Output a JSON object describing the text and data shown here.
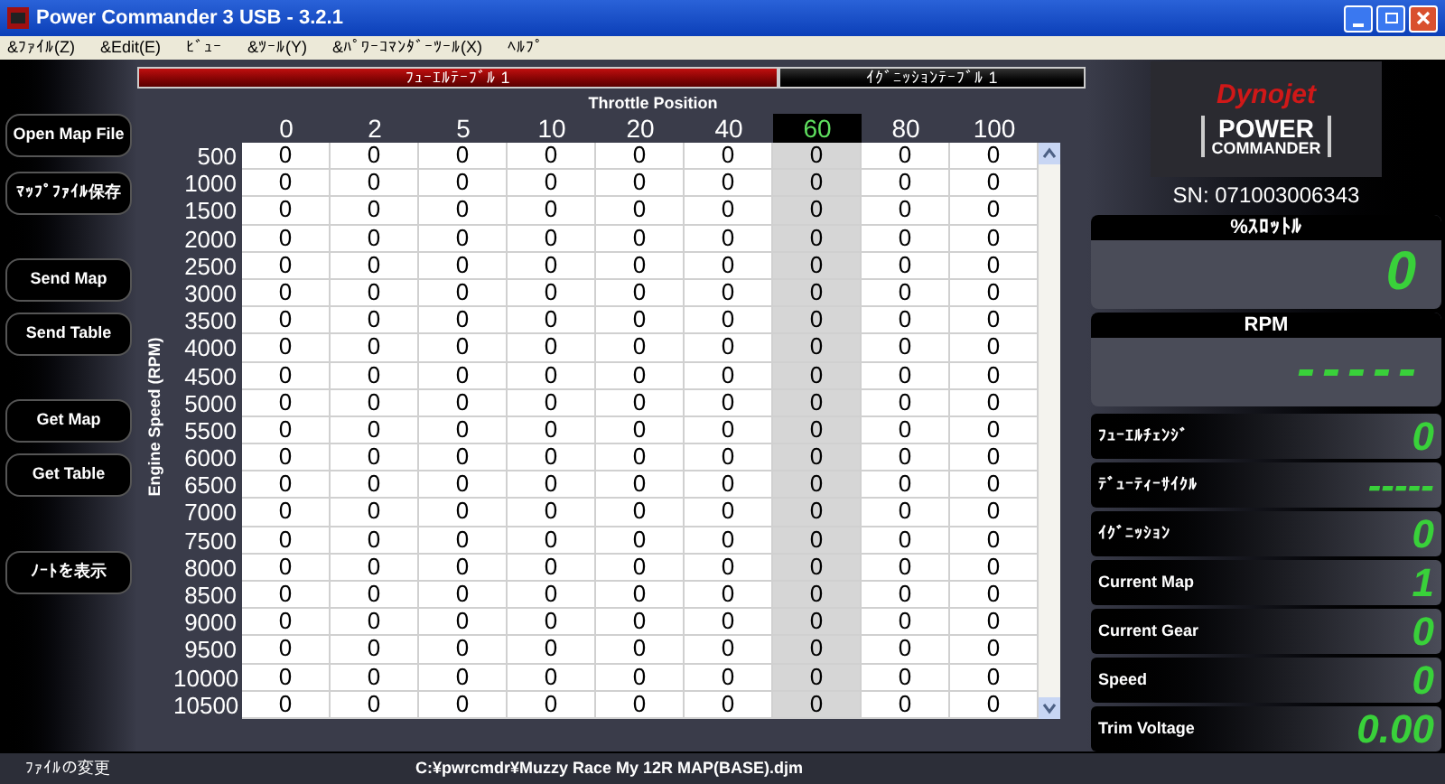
{
  "window": {
    "title": "Power Commander 3 USB - 3.2.1"
  },
  "menu": [
    "&ﾌｧｲﾙ(Z)",
    "&Edit(E)",
    "ﾋﾞｭｰ",
    "&ﾂｰﾙ(Y)",
    "&ﾊﾟﾜｰｺﾏﾝﾀﾞｰﾂｰﾙ(X)",
    "ﾍﾙﾌﾟ"
  ],
  "sidebar_buttons": [
    "Open Map File",
    "ﾏｯﾌﾟﾌｧｲﾙ保存",
    "Send Map",
    "Send Table",
    "Get Map",
    "Get Table",
    "ﾉｰﾄを表示"
  ],
  "tabs": [
    {
      "label": "ﾌｭｰｴﾙﾃｰﾌﾞﾙ 1",
      "selected": true
    },
    {
      "label": "ｲｸﾞﾆｯｼｮﾝﾃｰﾌﾞﾙ 1",
      "selected": false
    }
  ],
  "table": {
    "x_title": "Throttle Position",
    "y_title": "Engine Speed (RPM)",
    "columns": [
      {
        "label": "0",
        "selected": false
      },
      {
        "label": "2",
        "selected": false
      },
      {
        "label": "5",
        "selected": false
      },
      {
        "label": "10",
        "selected": false
      },
      {
        "label": "20",
        "selected": false
      },
      {
        "label": "40",
        "selected": false
      },
      {
        "label": "60",
        "selected": true
      },
      {
        "label": "80",
        "selected": false
      },
      {
        "label": "100",
        "selected": false
      }
    ],
    "rows": [
      {
        "rpm": "500",
        "cells": [
          "0",
          "0",
          "0",
          "0",
          "0",
          "0",
          "0",
          "0",
          "0"
        ]
      },
      {
        "rpm": "1000",
        "cells": [
          "0",
          "0",
          "0",
          "0",
          "0",
          "0",
          "0",
          "0",
          "0"
        ]
      },
      {
        "rpm": "1500",
        "cells": [
          "0",
          "0",
          "0",
          "0",
          "0",
          "0",
          "0",
          "0",
          "0"
        ]
      },
      {
        "rpm": "2000",
        "cells": [
          "0",
          "0",
          "0",
          "0",
          "0",
          "0",
          "0",
          "0",
          "0"
        ]
      },
      {
        "rpm": "2500",
        "cells": [
          "0",
          "0",
          "0",
          "0",
          "0",
          "0",
          "0",
          "0",
          "0"
        ]
      },
      {
        "rpm": "3000",
        "cells": [
          "0",
          "0",
          "0",
          "0",
          "0",
          "0",
          "0",
          "0",
          "0"
        ]
      },
      {
        "rpm": "3500",
        "cells": [
          "0",
          "0",
          "0",
          "0",
          "0",
          "0",
          "0",
          "0",
          "0"
        ]
      },
      {
        "rpm": "4000",
        "cells": [
          "0",
          "0",
          "0",
          "0",
          "0",
          "0",
          "0",
          "0",
          "0"
        ]
      },
      {
        "rpm": "4500",
        "cells": [
          "0",
          "0",
          "0",
          "0",
          "0",
          "0",
          "0",
          "0",
          "0"
        ]
      },
      {
        "rpm": "5000",
        "cells": [
          "0",
          "0",
          "0",
          "0",
          "0",
          "0",
          "0",
          "0",
          "0"
        ]
      },
      {
        "rpm": "5500",
        "cells": [
          "0",
          "0",
          "0",
          "0",
          "0",
          "0",
          "0",
          "0",
          "0"
        ]
      },
      {
        "rpm": "6000",
        "cells": [
          "0",
          "0",
          "0",
          "0",
          "0",
          "0",
          "0",
          "0",
          "0"
        ]
      },
      {
        "rpm": "6500",
        "cells": [
          "0",
          "0",
          "0",
          "0",
          "0",
          "0",
          "0",
          "0",
          "0"
        ]
      },
      {
        "rpm": "7000",
        "cells": [
          "0",
          "0",
          "0",
          "0",
          "0",
          "0",
          "0",
          "0",
          "0"
        ]
      },
      {
        "rpm": "7500",
        "cells": [
          "0",
          "0",
          "0",
          "0",
          "0",
          "0",
          "0",
          "0",
          "0"
        ]
      },
      {
        "rpm": "8000",
        "cells": [
          "0",
          "0",
          "0",
          "0",
          "0",
          "0",
          "0",
          "0",
          "0"
        ]
      },
      {
        "rpm": "8500",
        "cells": [
          "0",
          "0",
          "0",
          "0",
          "0",
          "0",
          "0",
          "0",
          "0"
        ]
      },
      {
        "rpm": "9000",
        "cells": [
          "0",
          "0",
          "0",
          "0",
          "0",
          "0",
          "0",
          "0",
          "0"
        ]
      },
      {
        "rpm": "9500",
        "cells": [
          "0",
          "0",
          "0",
          "0",
          "0",
          "0",
          "0",
          "0",
          "0"
        ]
      },
      {
        "rpm": "10000",
        "cells": [
          "0",
          "0",
          "0",
          "0",
          "0",
          "0",
          "0",
          "0",
          "0"
        ]
      },
      {
        "rpm": "10500",
        "cells": [
          "0",
          "0",
          "0",
          "0",
          "0",
          "0",
          "0",
          "0",
          "0"
        ]
      }
    ]
  },
  "logo": {
    "brand": "Dynojet",
    "product_line1": "POWER",
    "product_line2": "COMMANDER"
  },
  "serial": "SN: 071003006343",
  "big_gauges": [
    {
      "label": "%ｽﾛｯﾄﾙ",
      "value": "0"
    },
    {
      "label": "RPM",
      "value": "-----"
    }
  ],
  "small_gauges": [
    {
      "label": "ﾌｭｰｴﾙﾁｪﾝｼﾞ",
      "value": "0"
    },
    {
      "label": "ﾃﾞｭｰﾃｨｰｻｲｸﾙ",
      "value": "-----"
    },
    {
      "label": "ｲｸﾞﾆｯｼｮﾝ",
      "value": "0"
    },
    {
      "label": "Current Map",
      "value": "1"
    },
    {
      "label": "Current Gear",
      "value": "0"
    },
    {
      "label": "Speed",
      "value": "0"
    },
    {
      "label": "Trim Voltage",
      "value": "0.00"
    }
  ],
  "status_bar": {
    "message": "ﾌｧｲﾙの変更",
    "file_path": "C:¥pwrcmdr¥Muzzy Race My 12R MAP(BASE).djm"
  }
}
